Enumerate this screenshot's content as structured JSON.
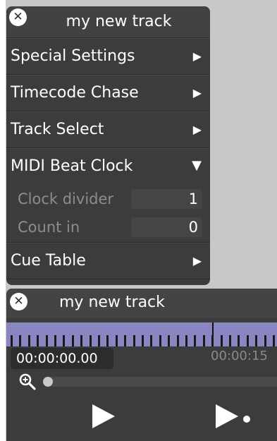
{
  "settings_panel": {
    "title": "my new track",
    "close_icon": "close-icon",
    "rows": [
      {
        "label": "Special Settings",
        "arrow": "▶"
      },
      {
        "label": "Timecode Chase",
        "arrow": "▶"
      },
      {
        "label": "Track Select",
        "arrow": "▶"
      },
      {
        "label": "MIDI Beat Clock",
        "arrow": "▼"
      },
      {
        "label": "Cue Table",
        "arrow": "▶"
      }
    ],
    "midi_beat_clock": {
      "clock_divider_label": "Clock divider",
      "clock_divider_value": "1",
      "count_in_label": "Count in",
      "count_in_value": "0"
    }
  },
  "transport": {
    "title": "my new track",
    "timecode": "00:00:00.00",
    "time_marker": "00:00:15",
    "zoom_level": 0.0,
    "timeline_color": "#8a86c2"
  },
  "colors": {
    "panel_bg": "#3c3c3c",
    "page_bg": "#c8c8c8",
    "muted_text": "#8d8d8d"
  }
}
